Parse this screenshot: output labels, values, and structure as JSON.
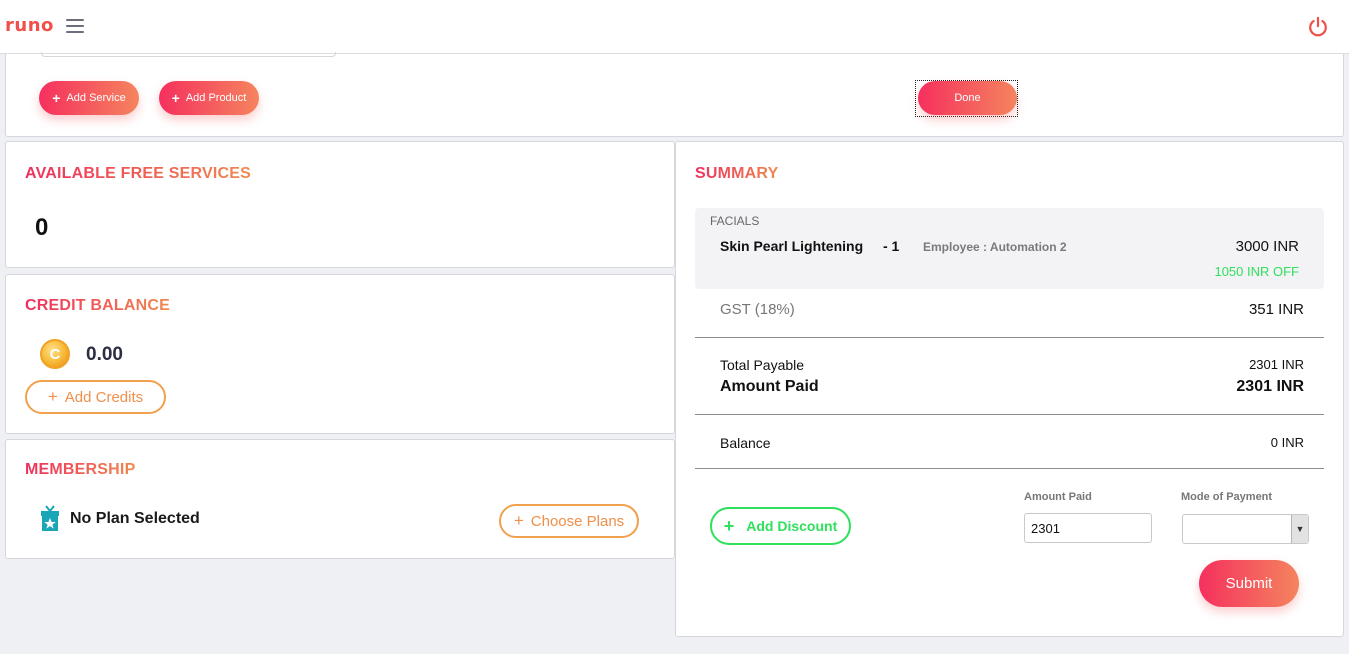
{
  "app": {
    "logo": "runo"
  },
  "icons": {
    "menu": "hamburger-icon",
    "power": "power-icon",
    "coin": "coin-icon",
    "gift": "gift-icon",
    "plus": "plus-icon",
    "dropdown": "chevron-down-icon"
  },
  "colors": {
    "accent_start": "#f5305e",
    "accent_end": "#f5845e",
    "orange": "#f08f4a",
    "green": "#2ee05c"
  },
  "toolbar": {
    "add_service": "Add Service",
    "add_product": "Add Product",
    "done": "Done"
  },
  "free_services": {
    "title": "AVAILABLE FREE SERVICES",
    "count": "0"
  },
  "credit": {
    "title": "CREDIT BALANCE",
    "coin_letter": "C",
    "amount": "0.00",
    "add_label": "Add Credits"
  },
  "membership": {
    "title": "MEMBERSHIP",
    "status": "No Plan Selected",
    "choose_label": "Choose Plans"
  },
  "summary": {
    "title": "SUMMARY",
    "item": {
      "category": "FACIALS",
      "name": "Skin Pearl Lightening",
      "qty": "- 1",
      "employee": "Employee : Automation 2",
      "price": "3000  INR",
      "discount": "1050 INR OFF"
    },
    "gst": {
      "label": "GST (18%)",
      "value": "351  INR"
    },
    "total_payable": {
      "label": "Total Payable",
      "value": "2301 INR"
    },
    "amount_paid": {
      "label": "Amount Paid",
      "value": "2301 INR"
    },
    "balance": {
      "label": "Balance",
      "value": "0 INR"
    },
    "add_discount": "Add Discount",
    "amount_paid_field": {
      "label": "Amount Paid",
      "value": "2301"
    },
    "mode_of_payment": {
      "label": "Mode of Payment",
      "selected": ""
    },
    "submit": "Submit"
  }
}
